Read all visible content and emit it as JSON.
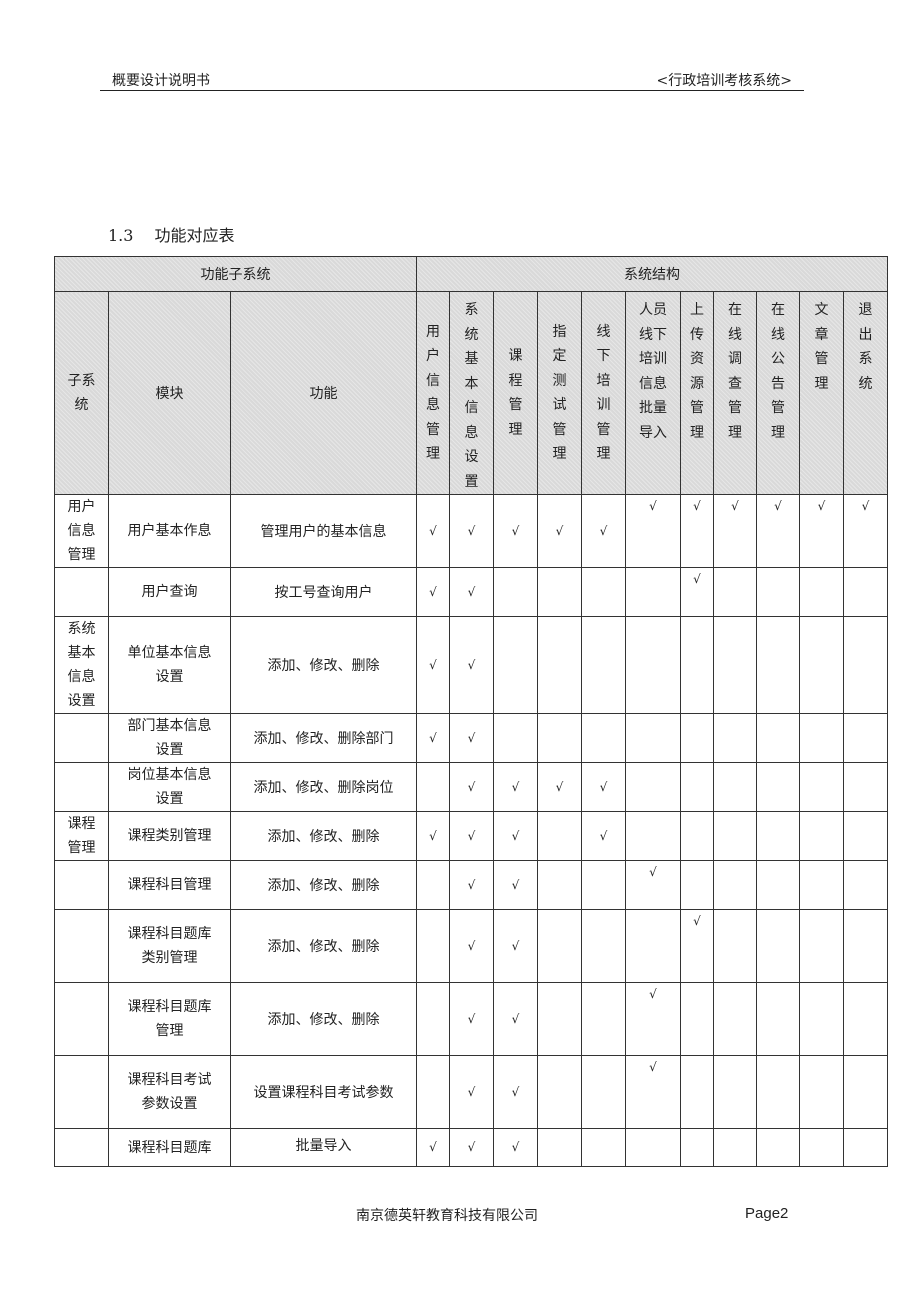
{
  "header": {
    "doc_title": "概要设计说明书",
    "system_name": "<行政培训考核系统>"
  },
  "section": {
    "number": "1.3",
    "title": "功能对应表"
  },
  "table": {
    "group_headers": {
      "left": "功能子系统",
      "right": "系统结构"
    },
    "left_columns": [
      "子系统",
      "模块",
      "功能"
    ],
    "structure_columns": [
      {
        "label": "用户信息管理",
        "chars": [
          "用",
          "户",
          "信",
          "息",
          "管",
          "理"
        ]
      },
      {
        "label": "系统基本信息设置",
        "chars": [
          "系",
          "统",
          "基",
          "本",
          "信",
          "息",
          "设",
          "置"
        ]
      },
      {
        "label": "课程管理",
        "chars": [
          "课",
          "程",
          "管",
          "理"
        ]
      },
      {
        "label": "指定测试管理",
        "chars": [
          "指",
          "定",
          "测",
          "试",
          "管",
          "理"
        ]
      },
      {
        "label": "线下培训管理",
        "chars": [
          "线",
          "下",
          "培",
          "训",
          "管",
          "理"
        ]
      },
      {
        "label": "人员线下培训信息批量导入",
        "chars": [
          "人员",
          "线下",
          "培训",
          "信息",
          "批量",
          "导入"
        ]
      },
      {
        "label": "上传资源管理",
        "chars": [
          "上",
          "传",
          "资",
          "源",
          "管",
          "理"
        ]
      },
      {
        "label": "在线调查管理",
        "chars": [
          "在",
          "线",
          "调",
          "查",
          "管",
          "理"
        ]
      },
      {
        "label": "在线公告管理",
        "chars": [
          "在",
          "线",
          "公",
          "告",
          "管",
          "理"
        ]
      },
      {
        "label": "文章管理",
        "chars": [
          "文",
          "章",
          "管",
          "理"
        ]
      },
      {
        "label": "退出系统",
        "chars": [
          "退",
          "出",
          "系",
          "统"
        ]
      }
    ],
    "check_symbol": "√",
    "rows": [
      {
        "subsystem": [
          "用户",
          "信息",
          "管理"
        ],
        "module": [
          "用户基本作息"
        ],
        "function": "管理用户的基本信息",
        "checks": [
          1,
          1,
          1,
          1,
          1,
          1,
          1,
          1,
          1,
          1,
          1
        ]
      },
      {
        "subsystem": [],
        "module": [
          "用户查询"
        ],
        "function": "按工号查询用户",
        "checks": [
          1,
          1,
          0,
          0,
          0,
          0,
          1,
          0,
          0,
          0,
          0
        ]
      },
      {
        "subsystem": [
          "系统",
          "基本",
          "信息",
          "设置"
        ],
        "module": [
          "单位基本信息",
          "设置"
        ],
        "function": "添加、修改、删除",
        "checks": [
          1,
          1,
          0,
          0,
          0,
          0,
          0,
          0,
          0,
          0,
          0
        ]
      },
      {
        "subsystem": [],
        "module": [
          "部门基本信息",
          "设置"
        ],
        "function": "添加、修改、删除部门",
        "checks": [
          1,
          1,
          0,
          0,
          0,
          0,
          0,
          0,
          0,
          0,
          0
        ]
      },
      {
        "subsystem": [],
        "module": [
          "岗位基本信息",
          "设置"
        ],
        "function": "添加、修改、删除岗位",
        "checks": [
          0,
          1,
          1,
          1,
          1,
          0,
          0,
          0,
          0,
          0,
          0
        ]
      },
      {
        "subsystem": [
          "课程",
          "管理"
        ],
        "module": [
          "课程类别管理"
        ],
        "function": "添加、修改、删除",
        "checks": [
          1,
          1,
          1,
          0,
          1,
          0,
          0,
          0,
          0,
          0,
          0
        ]
      },
      {
        "subsystem": [],
        "module": [
          "课程科目管理"
        ],
        "function": "添加、修改、删除",
        "checks": [
          0,
          1,
          1,
          0,
          0,
          1,
          0,
          0,
          0,
          0,
          0
        ]
      },
      {
        "subsystem": [],
        "module": [
          "课程科目题库",
          "类别管理"
        ],
        "function": "添加、修改、删除",
        "checks": [
          0,
          1,
          1,
          0,
          0,
          0,
          1,
          0,
          0,
          0,
          0
        ]
      },
      {
        "subsystem": [],
        "module": [
          "课程科目题库",
          "管理"
        ],
        "function": "添加、修改、删除",
        "checks": [
          0,
          1,
          1,
          0,
          0,
          1,
          0,
          0,
          0,
          0,
          0
        ]
      },
      {
        "subsystem": [],
        "module": [
          "课程科目考试",
          "参数设置"
        ],
        "function": "设置课程科目考试参数",
        "checks": [
          0,
          1,
          1,
          0,
          0,
          1,
          0,
          0,
          0,
          0,
          0
        ]
      },
      {
        "subsystem": [],
        "module": [
          "课程科目题库"
        ],
        "function": "批量导入",
        "checks": [
          1,
          1,
          1,
          0,
          0,
          0,
          0,
          0,
          0,
          0,
          0
        ]
      }
    ]
  },
  "footer": {
    "company": "南京德英轩教育科技有限公司",
    "page": "Page2"
  }
}
